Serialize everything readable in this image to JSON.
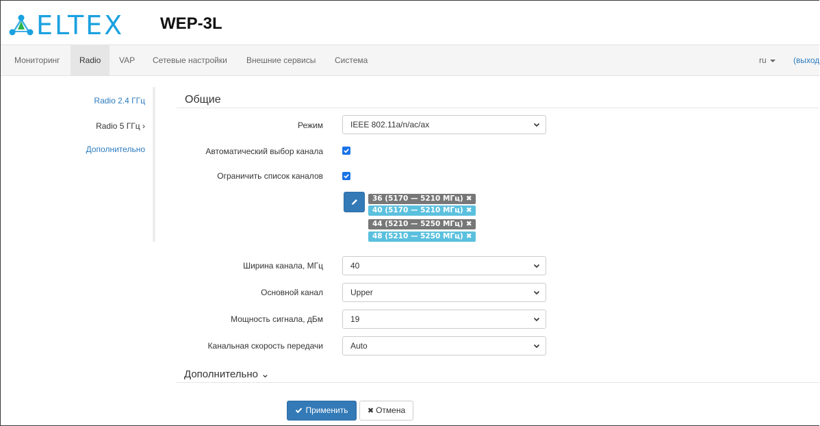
{
  "header": {
    "logo_text": "ELTEX",
    "model": "WEP-3L"
  },
  "nav": {
    "items": [
      {
        "label": "Мониторинг"
      },
      {
        "label": "Radio",
        "active": true
      },
      {
        "label": "VAP"
      },
      {
        "label": "Сетевые настройки"
      },
      {
        "label": "Внешние сервисы"
      },
      {
        "label": "Система"
      }
    ],
    "lang": "ru",
    "logout": "(выход"
  },
  "sidebar": {
    "items": [
      {
        "label": "Radio 2.4 ГГц"
      },
      {
        "label": "Radio 5 ГГц ›",
        "current": true
      },
      {
        "label": "Дополнительно"
      }
    ]
  },
  "section": {
    "title": "Общие",
    "advanced_title": "Дополнительно ⌄"
  },
  "form": {
    "mode": {
      "label": "Режим",
      "value": "IEEE 802.11a/n/ac/ax"
    },
    "auto_channel": {
      "label": "Автоматический выбор канала",
      "checked": true
    },
    "limit_channels": {
      "label": "Ограничить список каналов",
      "checked": true
    },
    "channels": [
      {
        "label": "36 (5170 — 5210 МГц)",
        "style": "dark"
      },
      {
        "label": "40 (5170 — 5210 МГц)",
        "style": "light"
      },
      {
        "label": "44 (5210 — 5250 МГц)",
        "style": "dark"
      },
      {
        "label": "48 (5210 — 5250 МГц)",
        "style": "light"
      }
    ],
    "channel_width": {
      "label": "Ширина канала, МГц",
      "value": "40"
    },
    "primary_channel": {
      "label": "Основной канал",
      "value": "Upper"
    },
    "tx_power": {
      "label": "Мощность сигнала, дБм",
      "value": "19"
    },
    "rate": {
      "label": "Канальная скорость передачи",
      "value": "Auto"
    }
  },
  "actions": {
    "apply": "Применить",
    "cancel": "Отмена"
  },
  "colors": {
    "brand": "#1aa1e0",
    "primary": "#337ab7",
    "tag_dark": "#777777",
    "tag_light": "#5bc0de",
    "checkbox": "#1a73e8"
  }
}
